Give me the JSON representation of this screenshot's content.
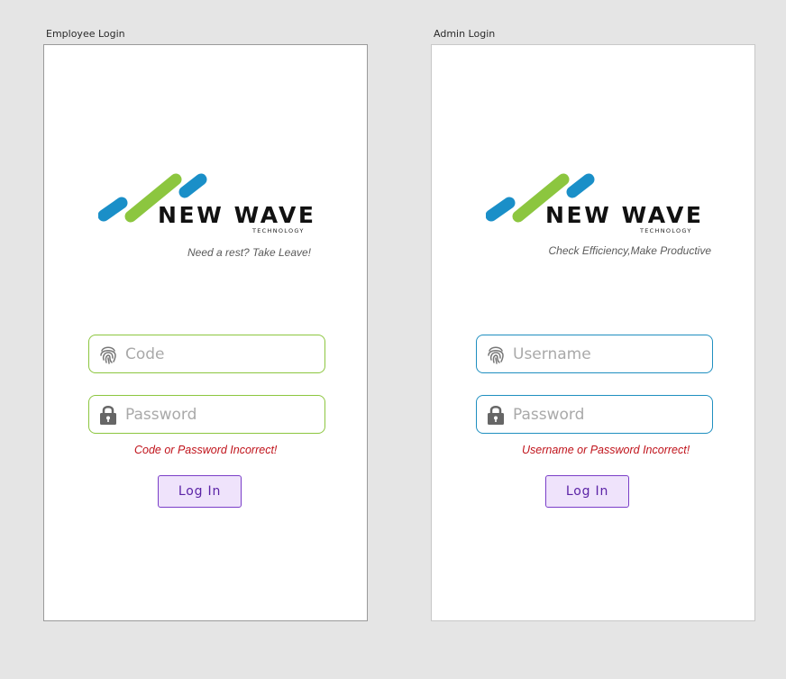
{
  "employee": {
    "frame_label": "Employee Login",
    "logo": {
      "word": "NEW WAVE",
      "sub": "TECHNOLOGY"
    },
    "tagline": "Need a rest? Take Leave!",
    "fields": {
      "code_placeholder": "Code",
      "password_placeholder": "Password"
    },
    "error": "Code or Password Incorrect!",
    "login_label": "Log In",
    "accent": "#8cc63f"
  },
  "admin": {
    "frame_label": "Admin Login",
    "logo": {
      "word": "NEW WAVE",
      "sub": "TECHNOLOGY"
    },
    "tagline": "Check Efficiency,Make Productive",
    "fields": {
      "username_placeholder": "Username",
      "password_placeholder": "Password"
    },
    "error": "Username or Password Incorrect!",
    "login_label": "Log In",
    "accent": "#1f8fc0"
  },
  "icons": [
    "fingerprint-icon",
    "lock-icon"
  ],
  "colors": {
    "logo_blue": "#1a8fc8",
    "logo_green": "#8cc63f",
    "error_red": "#c0131b",
    "button_purple": "#5b23a6"
  }
}
